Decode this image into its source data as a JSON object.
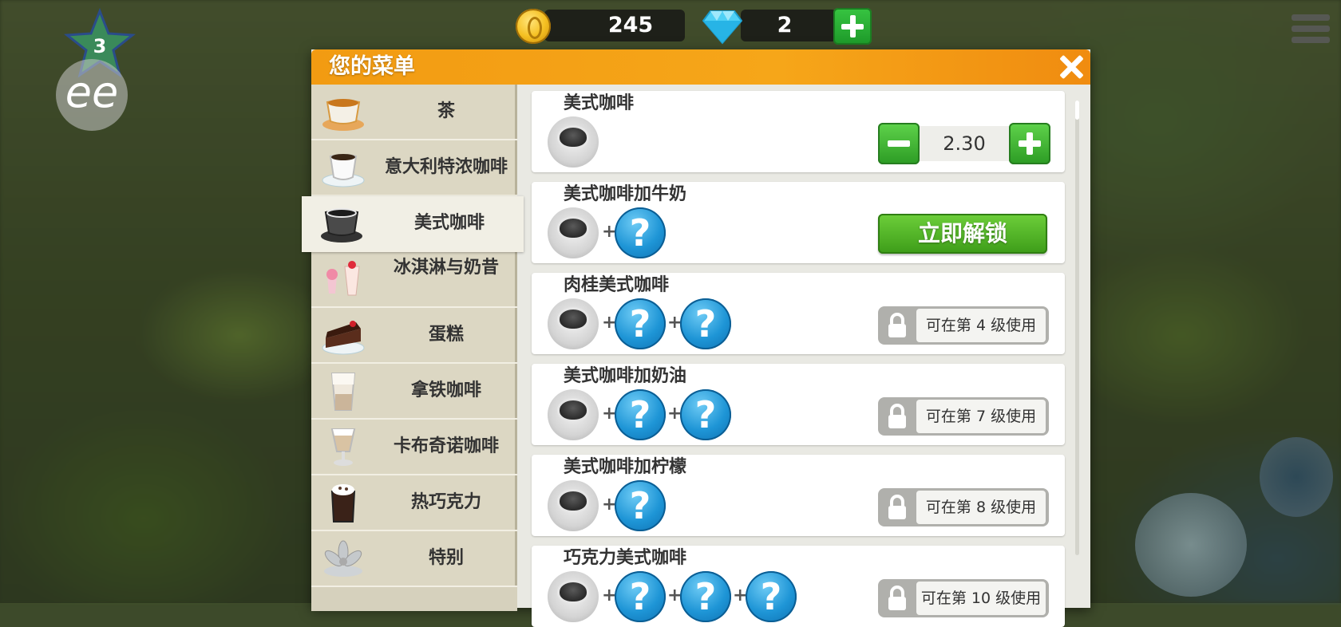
{
  "hud": {
    "coins": "245",
    "gems": "2",
    "level": "3",
    "ee_label": "ee",
    "coin_icon": "coin-icon",
    "gem_icon": "diamond-icon"
  },
  "dialog": {
    "title": "您的菜单",
    "accent_color": "#f29b12"
  },
  "categories": [
    {
      "label": "茶",
      "icon": "tea-cup-icon"
    },
    {
      "label": "意大利特浓咖啡",
      "icon": "espresso-cup-icon"
    },
    {
      "label": "美式咖啡",
      "icon": "americano-cup-icon",
      "active": true
    },
    {
      "label": "冰淇淋与奶昔",
      "icon": "ice-cream-icon"
    },
    {
      "label": "蛋糕",
      "icon": "cake-icon"
    },
    {
      "label": "拿铁咖啡",
      "icon": "latte-glass-icon"
    },
    {
      "label": "卡布奇诺咖啡",
      "icon": "cappuccino-glass-icon"
    },
    {
      "label": "热巧克力",
      "icon": "hot-chocolate-icon"
    },
    {
      "label": "特别",
      "icon": "special-flower-icon"
    }
  ],
  "items": [
    {
      "name": "美式咖啡",
      "price": "2.30",
      "unknown_ingredients": 0
    },
    {
      "name": "美式咖啡加牛奶",
      "unlock_label": "立即解锁",
      "unknown_ingredients": 1
    },
    {
      "name": "肉桂美式咖啡",
      "lock_text": "可在第 4 级使用",
      "unknown_ingredients": 2
    },
    {
      "name": "美式咖啡加奶油",
      "lock_text": "可在第 7 级使用",
      "unknown_ingredients": 2
    },
    {
      "name": "美式咖啡加柠檬",
      "lock_text": "可在第 8 级使用",
      "unknown_ingredients": 1
    },
    {
      "name": "巧克力美式咖啡",
      "lock_text": "可在第 10 级使用",
      "unknown_ingredients": 3
    }
  ],
  "symbols": {
    "plus": "+",
    "question": "?"
  }
}
